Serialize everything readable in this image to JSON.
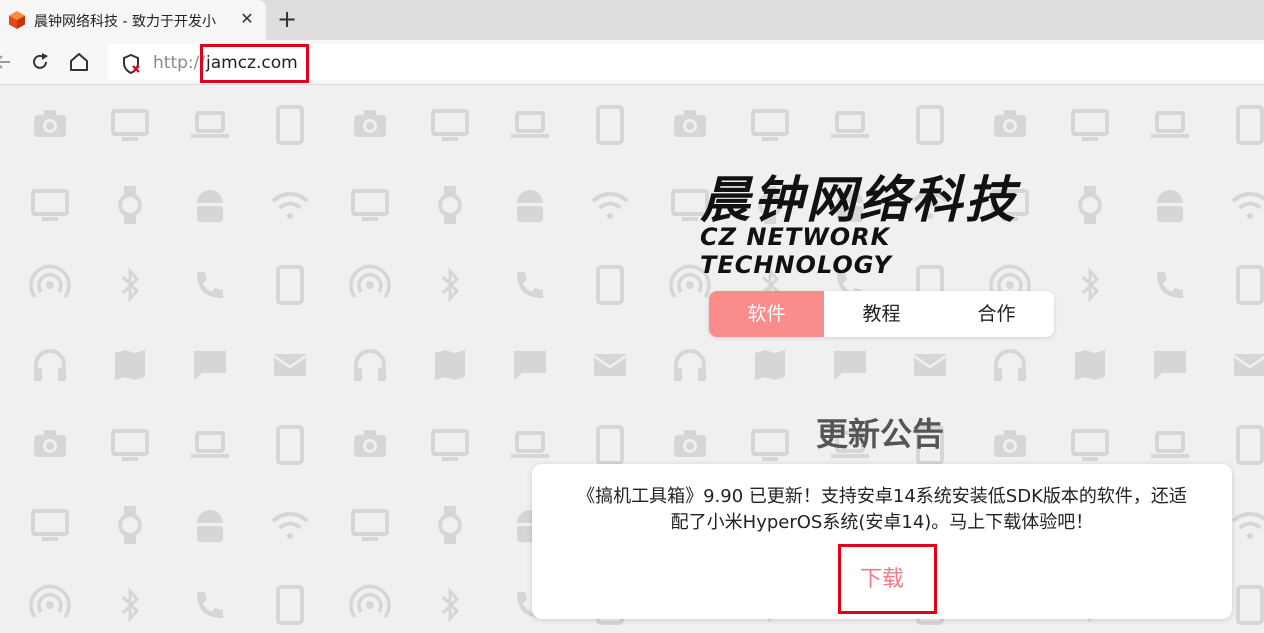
{
  "browser": {
    "tab": {
      "title": "晨钟网络科技 - 致力于开发小",
      "close": "✕"
    },
    "new_tab": "+",
    "address": {
      "scheme": "http://",
      "host": "jamcz.com"
    }
  },
  "page": {
    "brand_cn": "晨钟网络科技",
    "brand_en": "CZ NETWORK TECHNOLOGY",
    "tabs": [
      {
        "label": "软件",
        "active": true
      },
      {
        "label": "教程",
        "active": false
      },
      {
        "label": "合作",
        "active": false
      }
    ],
    "notice": {
      "heading": "更新公告",
      "line1": "《搞机工具箱》9.90 已更新！支持安卓14系统安装低SDK版本的软件，还适",
      "line2": "配了小米HyperOS系统(安卓14)。马上下载体验吧！",
      "download": "下载"
    }
  },
  "colors": {
    "accent": "#f98d8b",
    "download": "#f07a8a",
    "highlight_box": "#e0001b",
    "pattern_icon": "#d6d6d6"
  },
  "icons": {
    "favicon": "cube-icon",
    "back": "back-arrow-icon",
    "reload": "reload-icon",
    "home": "home-icon",
    "security": "not-secure-shield-icon",
    "pattern": [
      "camera-icon",
      "monitor-icon",
      "laptop-icon",
      "tablet-icon",
      "watch-icon",
      "android-icon",
      "wifi-icon",
      "bluetooth-icon",
      "phone-icon",
      "headphones-icon",
      "map-icon",
      "chat-icon",
      "mail-icon",
      "hotspot-icon"
    ]
  }
}
